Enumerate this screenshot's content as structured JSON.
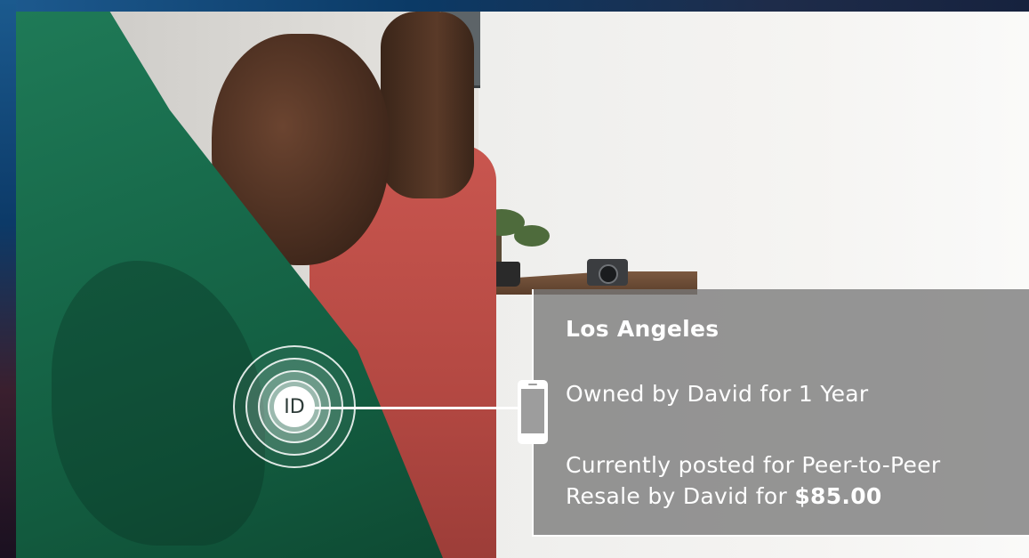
{
  "beacon": {
    "label": "ID"
  },
  "listing": {
    "city": "Los Angeles",
    "ownership": "Owned by David for 1 Year",
    "resale_line1": "Currently posted for Peer-to-Peer",
    "resale_line2_prefix": "Resale by David for ",
    "price": "$85.00"
  },
  "colors": {
    "panel_bg": "#787878",
    "accent_white": "#ffffff",
    "shirt_green": "#1f7a57",
    "shirt_red": "#c9564f"
  },
  "icons": [
    "id-beacon-icon",
    "phone-icon"
  ]
}
